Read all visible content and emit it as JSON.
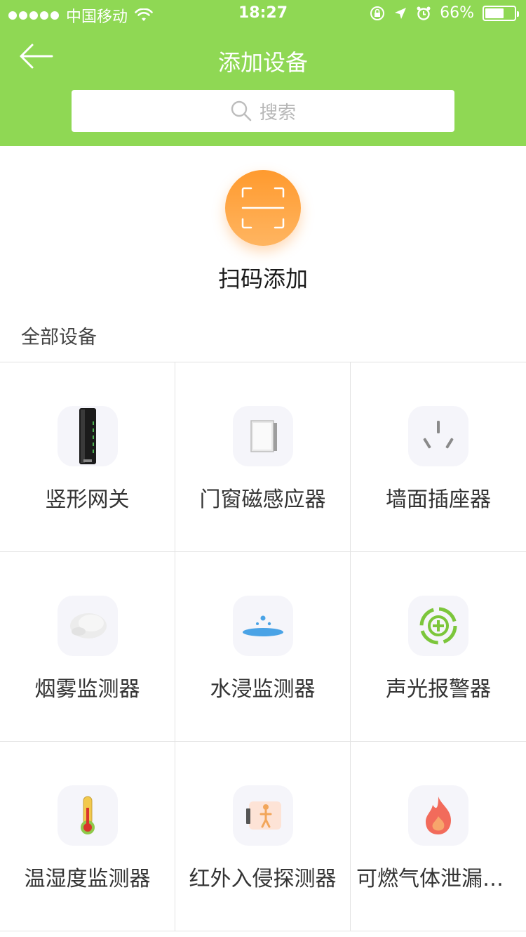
{
  "status_bar": {
    "carrier": "中国移动",
    "time": "18:27",
    "battery": "66%",
    "battery_level": 0.66
  },
  "nav": {
    "title": "添加设备",
    "back_icon": "back-arrow-icon"
  },
  "search": {
    "placeholder": "搜索",
    "icon": "search-icon"
  },
  "scan": {
    "label": "扫码添加",
    "icon": "scan-frame-icon",
    "color": "#ff9a2e"
  },
  "section": {
    "title": "全部设备"
  },
  "devices": [
    {
      "label": "竖形网关",
      "icon": "gateway-icon"
    },
    {
      "label": "门窗磁感应器",
      "icon": "door-sensor-icon"
    },
    {
      "label": "墙面插座器",
      "icon": "wall-socket-icon"
    },
    {
      "label": "烟雾监测器",
      "icon": "smoke-detector-icon"
    },
    {
      "label": "水浸监测器",
      "icon": "water-leak-icon"
    },
    {
      "label": "声光报警器",
      "icon": "alarm-icon"
    },
    {
      "label": "温湿度监测器",
      "icon": "thermometer-icon"
    },
    {
      "label": "红外入侵探测器",
      "icon": "infrared-detector-icon"
    },
    {
      "label": "可燃气体泄漏检测器",
      "icon": "gas-flame-icon"
    }
  ],
  "colors": {
    "header": "#8fd854",
    "accent_orange": "#ff9a2e"
  }
}
